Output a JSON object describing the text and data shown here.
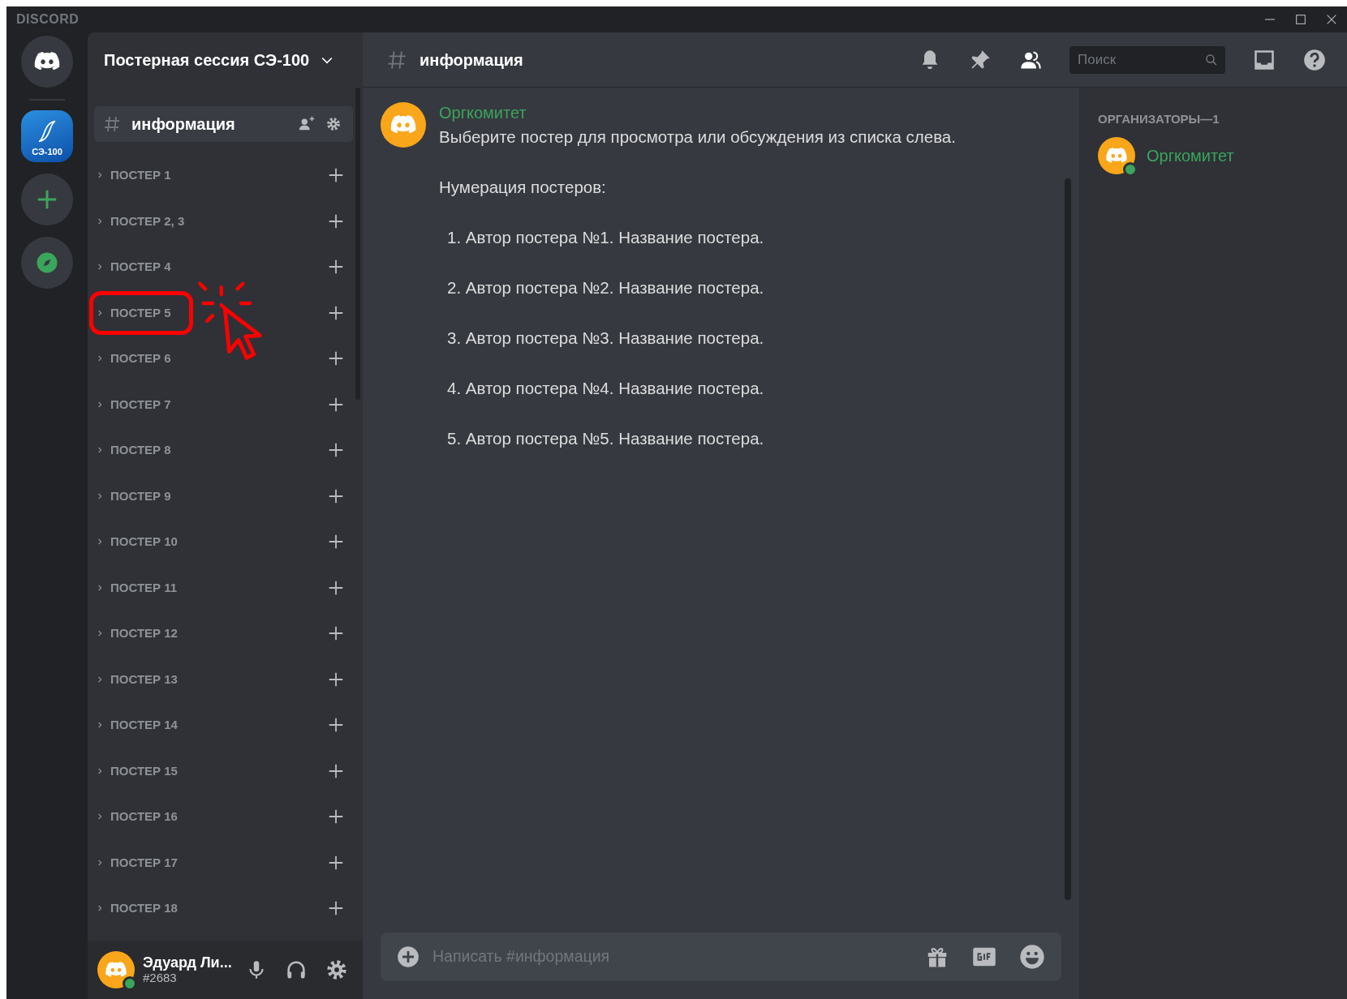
{
  "window": {
    "app_name": "DISCORD"
  },
  "servers": [
    {
      "kind": "home",
      "selected": false
    },
    {
      "kind": "server",
      "label": "СЭ-100",
      "selected": true
    },
    {
      "kind": "add",
      "selected": false
    },
    {
      "kind": "explore",
      "selected": false
    }
  ],
  "sidebar": {
    "server_name": "Постерная сессия СЭ-100",
    "channels": [
      {
        "name": "информация",
        "selected": true
      }
    ],
    "categories": [
      {
        "label": "ПОСТЕР 1",
        "highlighted": false
      },
      {
        "label": "ПОСТЕР 2, 3",
        "highlighted": false
      },
      {
        "label": "ПОСТЕР 4",
        "highlighted": false
      },
      {
        "label": "ПОСТЕР 5",
        "highlighted": true
      },
      {
        "label": "ПОСТЕР 6",
        "highlighted": false
      },
      {
        "label": "ПОСТЕР 7",
        "highlighted": false
      },
      {
        "label": "ПОСТЕР 8",
        "highlighted": false
      },
      {
        "label": "ПОСТЕР 9",
        "highlighted": false
      },
      {
        "label": "ПОСТЕР 10",
        "highlighted": false
      },
      {
        "label": "ПОСТЕР 11",
        "highlighted": false
      },
      {
        "label": "ПОСТЕР 12",
        "highlighted": false
      },
      {
        "label": "ПОСТЕР 13",
        "highlighted": false
      },
      {
        "label": "ПОСТЕР 14",
        "highlighted": false
      },
      {
        "label": "ПОСТЕР 15",
        "highlighted": false
      },
      {
        "label": "ПОСТЕР 16",
        "highlighted": false
      },
      {
        "label": "ПОСТЕР 17",
        "highlighted": false
      },
      {
        "label": "ПОСТЕР 18",
        "highlighted": false
      }
    ],
    "user": {
      "name": "Эдуард Ли...",
      "tag": "#2683",
      "online": true
    }
  },
  "header": {
    "channel": "информация",
    "search": {
      "placeholder": "Поиск"
    }
  },
  "messages": [
    {
      "author": "Оргкомитет",
      "paragraphs": [
        {
          "kind": "text",
          "text": "Выберите постер для просмотра или обсуждения из списка слева."
        },
        {
          "kind": "text",
          "text": "Нумерация постеров:"
        },
        {
          "kind": "list_item",
          "text": "1. Автор постера №1. Название постера."
        },
        {
          "kind": "list_item",
          "text": "2. Автор постера №2. Название постера."
        },
        {
          "kind": "list_item",
          "text": "3. Автор постера №3. Название постера."
        },
        {
          "kind": "list_item",
          "text": "4. Автор постера №4. Название постера."
        },
        {
          "kind": "list_item",
          "text": "5. Автор постера №5. Название постера."
        }
      ]
    }
  ],
  "composer": {
    "placeholder": "Написать #информация"
  },
  "members": {
    "group": "ОРГАНИЗАТОРЫ—1",
    "items": [
      {
        "name": "Оргкомитет",
        "online": true
      }
    ]
  }
}
